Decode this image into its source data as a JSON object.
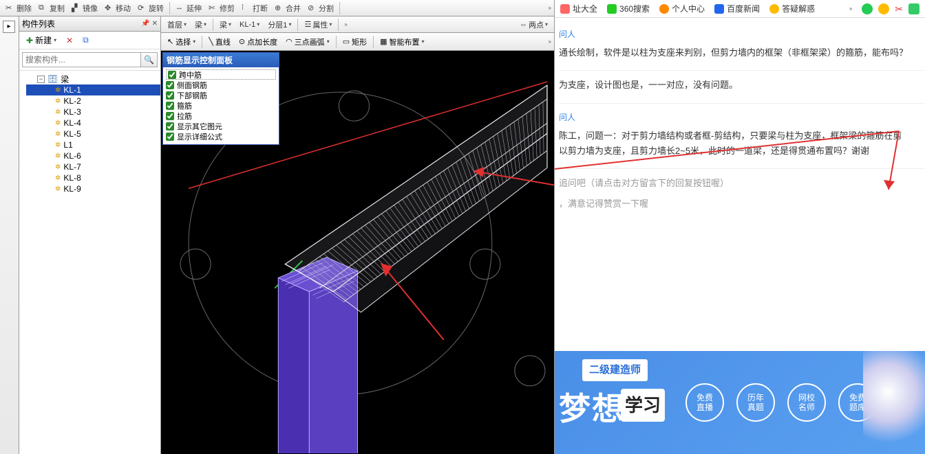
{
  "toolbar": {
    "delete": "删除",
    "copy": "复制",
    "mirror": "镜像",
    "move": "移动",
    "rotate": "旋转",
    "extend": "延伸",
    "trim": "修剪",
    "break": "打断",
    "merge": "合并",
    "split": "分割"
  },
  "side_panel": {
    "title": "构件列表",
    "new_btn": "新建",
    "search_placeholder": "搜索构件...",
    "root": "梁",
    "items": [
      "KL-1",
      "KL-2",
      "KL-3",
      "KL-4",
      "KL-5",
      "L1",
      "KL-6",
      "KL-7",
      "KL-8",
      "KL-9"
    ],
    "selected": "KL-1"
  },
  "subbar": {
    "floor": "首层",
    "cat": "梁",
    "cat2": "梁",
    "member": "KL-1",
    "layer": "分层1",
    "prop": "属性",
    "twopt": "两点"
  },
  "toolsbar": {
    "select": "选择",
    "line": "直线",
    "addlen": "点加长度",
    "arc3": "三点画弧",
    "rect": "矩形",
    "smart": "智能布置"
  },
  "control_panel": {
    "title": "钢筋显示控制面板",
    "rows": [
      "跨中筋",
      "侧面钢筋",
      "下部钢筋",
      "箍筋",
      "拉筋",
      "显示其它图元",
      "显示详细公式"
    ]
  },
  "browser": {
    "tabs": {
      "sites": "址大全",
      "s360": "360搜索",
      "personal": "个人中心",
      "baidu": "百度新闻",
      "qa": "答疑解惑"
    },
    "qa_user1": "问人",
    "qa_text1": "通长绘制，软件是以柱为支座来判别，但剪力墙内的框架（非框架梁）的箍筋，能布吗？",
    "qa_text2": "为支座，设计图也是，一一对应，没有问题。",
    "qa_user2": "问人",
    "qa_text3": "陈工，问题一：对于剪力墙结构或者框-剪结构，只要梁与柱为支座，框架梁的箍筋在剪",
    "qa_text3b": "以剪力墙为支座，且剪力墙长2~5米，此时的一道梁，还是得贯通布置吗？谢谢",
    "hint1": "追问吧（请点击对方留言下的回复按钮喔）",
    "hint2": "，满意记得赞赏一下喔"
  },
  "ad": {
    "badge": "二级建造师",
    "dream": "梦想",
    "study": "学习",
    "circles": [
      "免费\n直播",
      "历年\n真题",
      "网校\n名师",
      "免费\n题库"
    ]
  }
}
